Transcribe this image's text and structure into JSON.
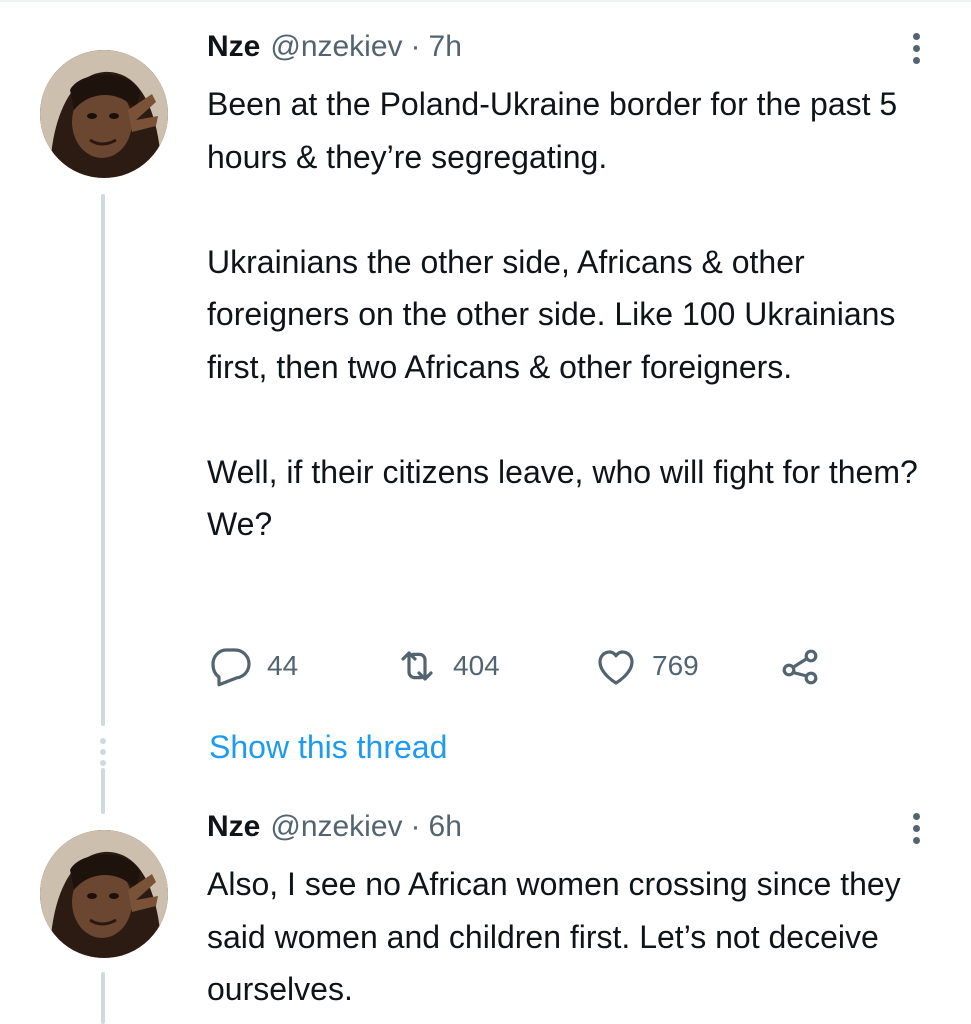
{
  "tweets": [
    {
      "author_name": "Nze",
      "handle": "@nzekiev",
      "separator": "·",
      "time": "7h",
      "paragraphs": [
        "Been at the Poland-Ukraine border for the past 5 hours & they’re segregating.",
        "Ukrainians the other side, Africans & other foreigners on the other side. Like 100 Ukrainians first, then two Africans & other foreigners.",
        "Well, if their citizens leave, who will fight for them? We?"
      ],
      "replies": "44",
      "retweets": "404",
      "likes": "769",
      "avatar_icon": "profile-photo",
      "more_icon": "more-vertical-icon"
    },
    {
      "author_name": "Nze",
      "handle": "@nzekiev",
      "separator": "·",
      "time": "6h",
      "paragraphs": [
        "Also, I see no African women crossing since they said women and children first. Let’s not deceive ourselves."
      ],
      "avatar_icon": "profile-photo",
      "more_icon": "more-vertical-icon"
    }
  ],
  "show_thread_label": "Show this thread",
  "colors": {
    "text": "#0f1419",
    "secondary": "#536471",
    "link": "#1d9bf0",
    "thread_line": "#cfd9de"
  },
  "icons": {
    "reply": "reply-icon",
    "retweet": "retweet-icon",
    "like": "like-icon",
    "share": "share-icon"
  }
}
